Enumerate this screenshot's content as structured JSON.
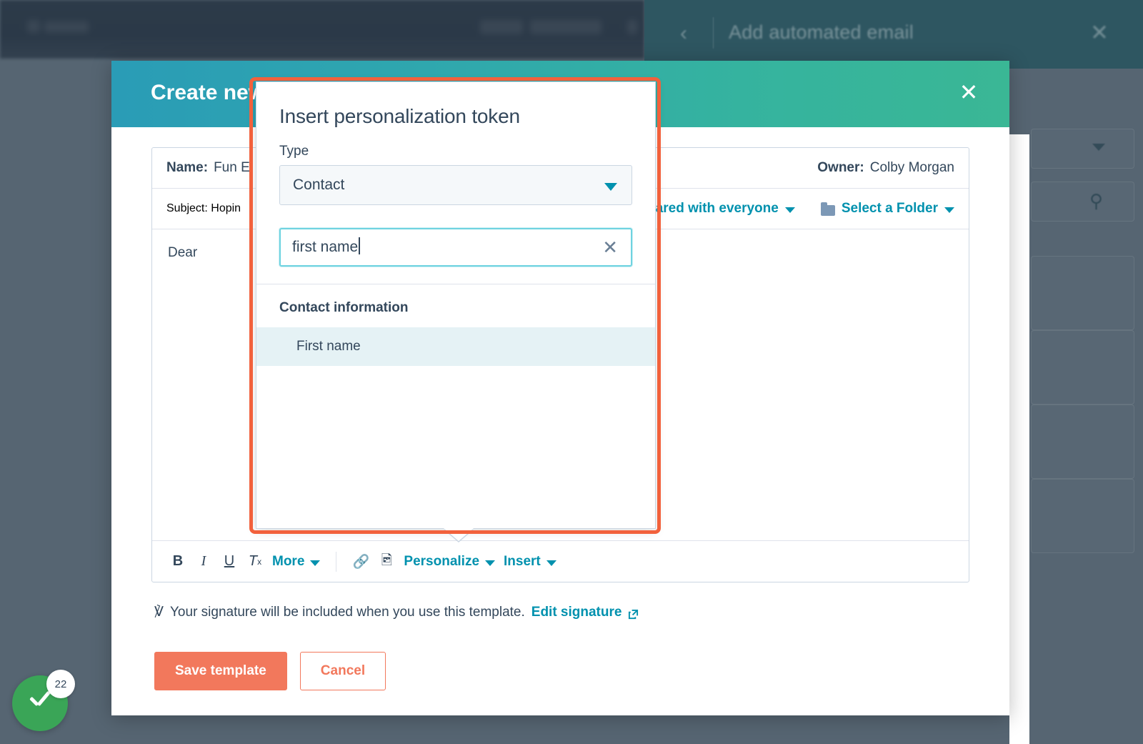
{
  "background": {
    "topbar_right": {
      "back_icon": "chevron-left-icon",
      "title": "Add automated email",
      "close_icon": "close-icon"
    },
    "right_panel": {
      "dropdown_icon": "chevron-down-icon",
      "search_icon": "search-icon"
    }
  },
  "toast": {
    "icon": "check-circle-icon",
    "count": "22"
  },
  "modal": {
    "title": "Create new",
    "close_icon": "close-icon",
    "fields": {
      "name_label": "Name:",
      "name_value": "Fun E",
      "owner_label": "Owner:",
      "owner_value": "Colby Morgan",
      "subject_label": "Subject:",
      "subject_value": "Hopin"
    },
    "sharing": {
      "shared_label": "ared with everyone",
      "folder_label": "Select a Folder",
      "folder_icon": "folder-icon"
    },
    "editor": {
      "body_text": "Dear"
    },
    "toolbar": {
      "bold": "B",
      "italic": "I",
      "underline": "U",
      "clear_format": "T",
      "clear_format_sub": "x",
      "more": "More",
      "link_icon": "link-icon",
      "image_icon": "image-icon",
      "personalize": "Personalize",
      "insert": "Insert"
    },
    "signature": {
      "icon": "signature-icon",
      "text": "Your signature will be included when you use this template.",
      "link": "Edit signature",
      "external_icon": "external-link-icon"
    },
    "actions": {
      "save": "Save template",
      "cancel": "Cancel"
    }
  },
  "popover": {
    "title": "Insert personalization token",
    "type_label": "Type",
    "type_value": "Contact",
    "type_caret_icon": "caret-down-icon",
    "search_value": "first name",
    "search_clear_icon": "close-icon",
    "group_title": "Contact information",
    "options": [
      {
        "label": "First name"
      }
    ]
  },
  "colors": {
    "accent_orange": "#f2785c",
    "highlight_orange": "#f2613c",
    "link_teal": "#0091ae",
    "header_gradient_start": "#2a9cb6",
    "header_gradient_end": "#3ab795",
    "text_dark": "#33475b",
    "backdrop": "#566572",
    "option_highlight": "#e5f2f5",
    "success_green": "#3aa557"
  }
}
